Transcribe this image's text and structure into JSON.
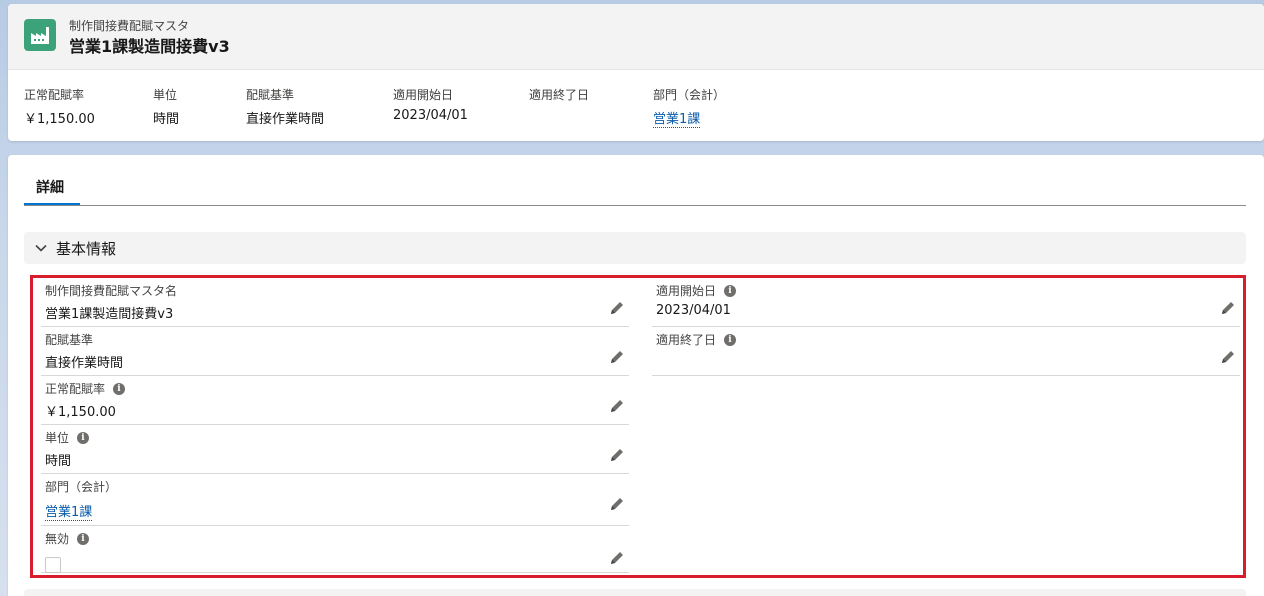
{
  "header": {
    "object_type": "制作間接費配賦マスタ",
    "record_name": "営業1課製造間接費v3",
    "icon": "factory-icon",
    "icon_color": "#3ba27a",
    "highlights": [
      {
        "label": "正常配賦率",
        "value": "￥1,150.00"
      },
      {
        "label": "単位",
        "value": "時間"
      },
      {
        "label": "配賦基準",
        "value": "直接作業時間"
      },
      {
        "label": "適用開始日",
        "value": "2023/04/01"
      },
      {
        "label": "適用終了日",
        "value": ""
      },
      {
        "label": "部門（会計）",
        "value": "営業1課"
      }
    ]
  },
  "tabs": [
    {
      "label": "詳細",
      "active": true
    }
  ],
  "section": {
    "title": "基本情報",
    "icon": "chevron-down-icon"
  },
  "fields": {
    "left": [
      {
        "label": "制作間接費配賦マスタ名",
        "value": "営業1課製造間接費v3",
        "info": false
      },
      {
        "label": "配賦基準",
        "value": "直接作業時間",
        "info": false
      },
      {
        "label": "正常配賦率",
        "value": "￥1,150.00",
        "info": true
      },
      {
        "label": "単位",
        "value": "時間",
        "info": true
      },
      {
        "label": "部門（会計）",
        "value": "営業1課",
        "info": false
      },
      {
        "label": "無効",
        "value": "",
        "info": true
      }
    ],
    "right": [
      {
        "label": "適用開始日",
        "value": "2023/04/01",
        "info": true
      },
      {
        "label": "適用終了日",
        "value": "",
        "info": true
      }
    ]
  },
  "info_glyph": "i",
  "accent_color": "#0176d3",
  "highlight_color": "#d81e2c",
  "link_color": "#0b5cab"
}
